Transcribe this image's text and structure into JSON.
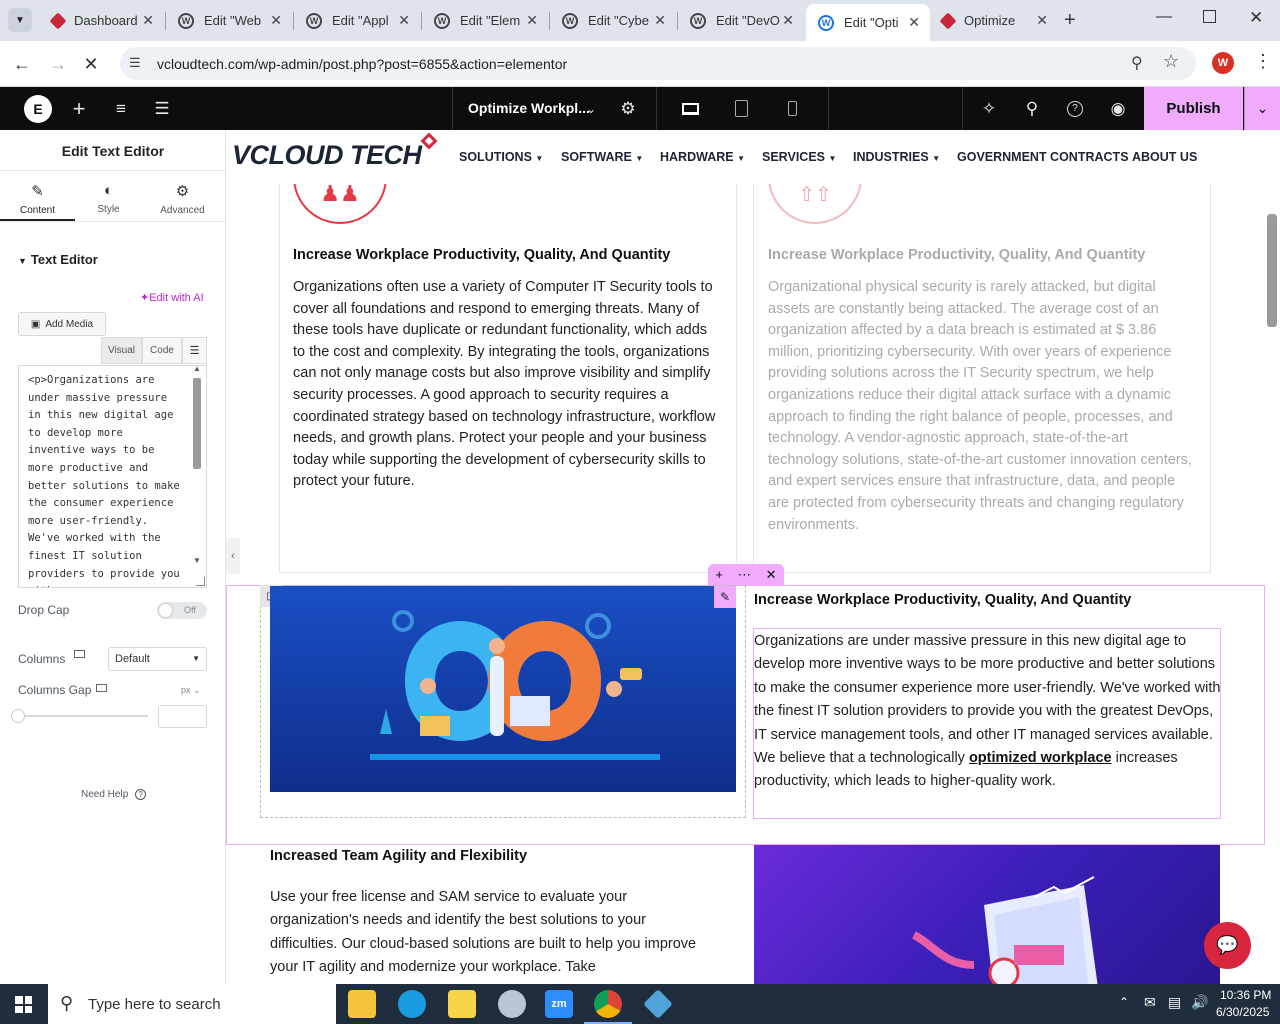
{
  "browser": {
    "tabs": [
      {
        "title": "Dashboard",
        "icon": "vcloud-favicon"
      },
      {
        "title": "Edit \"Web",
        "icon": "wordpress-favicon"
      },
      {
        "title": "Edit \"Appl",
        "icon": "wordpress-favicon"
      },
      {
        "title": "Edit \"Elem",
        "icon": "wordpress-favicon"
      },
      {
        "title": "Edit \"Cybe",
        "icon": "wordpress-favicon"
      },
      {
        "title": "Edit \"DevO",
        "icon": "wordpress-favicon"
      },
      {
        "title": "Edit \"Opti",
        "icon": "wordpress-favicon"
      },
      {
        "title": "Optimize",
        "icon": "vcloud-favicon"
      }
    ],
    "active_tab": 6,
    "url": "vcloudtech.com/wp-admin/post.php?post=6855&action=elementor",
    "profile_initial": "W"
  },
  "elementor": {
    "page_title": "Optimize Workpl...",
    "publish_label": "Publish"
  },
  "panel": {
    "title": "Edit Text Editor",
    "tabs": [
      "Content",
      "Style",
      "Advanced"
    ],
    "section": "Text Editor",
    "edit_ai": "Edit with AI",
    "add_media": "Add Media",
    "visual": "Visual",
    "code": "Code",
    "editor_text": "<p>Organizations are under massive pressure in this new digital age to develop more inventive ways to be more productive and better solutions to make the consumer experience more user-friendly. We've worked with the finest IT solution providers to provide you with",
    "drop_cap": "Drop Cap",
    "drop_cap_value": "Off",
    "columns": "Columns",
    "columns_value": "Default",
    "columns_gap": "Columns Gap",
    "gap_unit": "px",
    "need_help": "Need Help"
  },
  "site": {
    "logo": "VCLOUD TECH",
    "menu": [
      "SOLUTIONS",
      "SOFTWARE",
      "HARDWARE",
      "SERVICES",
      "INDUSTRIES",
      "GOVERNMENT CONTRACTS",
      "ABOUT US"
    ],
    "card1": {
      "heading": "Increase Workplace Productivity, Quality, And Quantity",
      "text": "Organizations often use a variety of Computer IT Security tools to cover all foundations and respond to emerging threats. Many of these tools have duplicate or redundant functionality, which adds to the cost and complexity. By integrating the tools, organizations can not only manage costs but also improve visibility and simplify security processes. A good approach to security requires a coordinated strategy based on technology infrastructure, workflow needs, and growth plans. Protect your people and your business today while supporting the development of cybersecurity skills to protect your future."
    },
    "card2": {
      "heading": "Increase Workplace Productivity, Quality, And Quantity",
      "text": "Organizational physical security is rarely attacked, but digital assets are constantly being attacked. The average cost of an organization affected by a data breach is estimated at $ 3.86 million, prioritizing cybersecurity. With over years of experience providing solutions across the IT Security spectrum, we help organizations reduce their digital attack surface with a dynamic approach to finding the right balance of people, processes, and technology. A vendor-agnostic approach, state-of-the-art technology solutions, state-of-the-art customer innovation centers, and expert services ensure that infrastructure, data, and people are protected from cybersecurity threats and changing regulatory environments."
    },
    "section2": {
      "heading": "Increase Workplace Productivity, Quality, And Quantity",
      "text_before": "Organizations are under massive pressure in this new digital age to develop more inventive ways to be more productive and better solutions to make the consumer experience more user-friendly. We've worked with the finest IT solution providers to provide you with the greatest DevOps, IT service management tools, and other IT managed services available. We believe that a technologically ",
      "link": "optimized workplace",
      "text_after": " increases productivity, which leads to higher-quality work."
    },
    "section3": {
      "heading": "Increased Team Agility and Flexibility",
      "text": "Use your free license and SAM service to evaluate your organization's needs and identify the best solutions to your difficulties. Our cloud-based solutions are built to help you improve your IT agility and modernize your workplace. Take"
    }
  },
  "taskbar": {
    "search_placeholder": "Type here to search",
    "time": "10:36 PM",
    "date": "6/30/2025"
  }
}
